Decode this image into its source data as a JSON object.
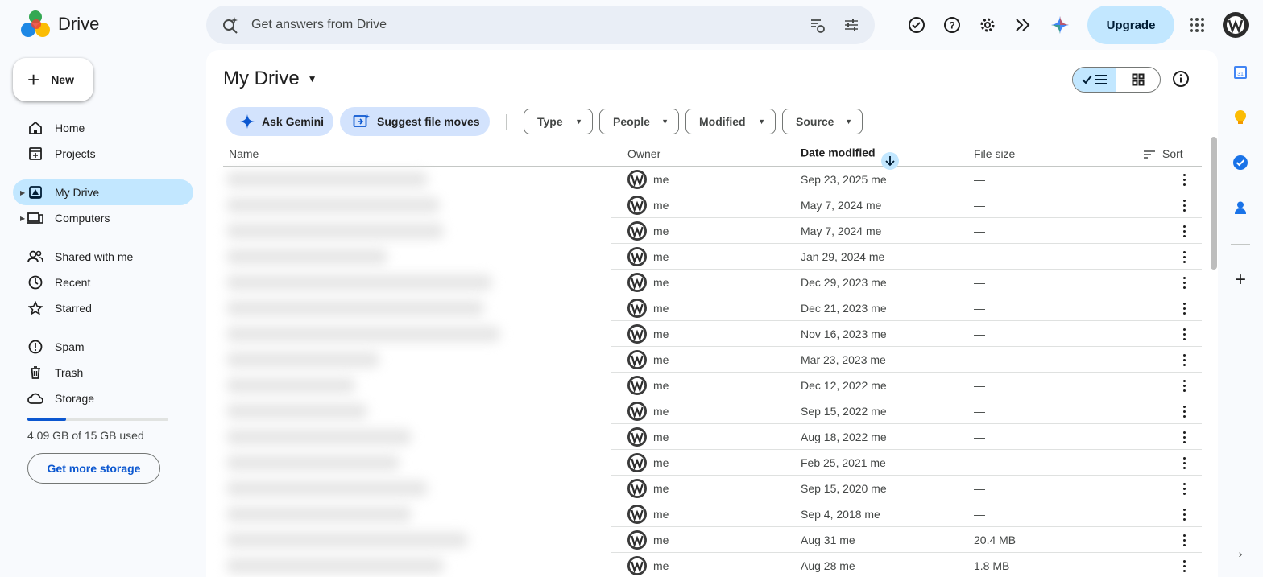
{
  "app": {
    "name": "Drive"
  },
  "search": {
    "placeholder": "Get answers from Drive"
  },
  "header": {
    "upgrade_label": "Upgrade",
    "icons": [
      "ready-for-offline-icon",
      "help-icon",
      "settings-icon",
      "gemini-workspace-icon",
      "gemini-sparkle-icon",
      "apps-grid-icon",
      "account-avatar"
    ]
  },
  "sidebar": {
    "new_label": "New",
    "items": [
      {
        "label": "Home",
        "icon": "home-icon"
      },
      {
        "label": "Projects",
        "icon": "projects-icon"
      },
      {
        "label": "My Drive",
        "icon": "my-drive-icon",
        "active": true
      },
      {
        "label": "Computers",
        "icon": "computers-icon"
      },
      {
        "label": "Shared with me",
        "icon": "shared-icon"
      },
      {
        "label": "Recent",
        "icon": "clock-icon"
      },
      {
        "label": "Starred",
        "icon": "star-icon"
      },
      {
        "label": "Spam",
        "icon": "spam-icon"
      },
      {
        "label": "Trash",
        "icon": "trash-icon"
      },
      {
        "label": "Storage",
        "icon": "cloud-icon"
      }
    ],
    "storage": {
      "text": "4.09 GB of 15 GB used",
      "used_fraction": 0.273,
      "button": "Get more storage"
    }
  },
  "main": {
    "title": "My Drive",
    "actions": {
      "ask_gemini": "Ask Gemini",
      "suggest_moves": "Suggest file moves"
    },
    "filters": [
      "Type",
      "People",
      "Modified",
      "Source"
    ],
    "columns": {
      "name": "Name",
      "owner": "Owner",
      "date": "Date modified",
      "size": "File size",
      "sort": "Sort"
    },
    "rows": [
      {
        "owner": "me",
        "date": "Sep 23, 2025 me",
        "size": "—"
      },
      {
        "owner": "me",
        "date": "May 7, 2024 me",
        "size": "—"
      },
      {
        "owner": "me",
        "date": "May 7, 2024 me",
        "size": "—"
      },
      {
        "owner": "me",
        "date": "Jan 29, 2024 me",
        "size": "—"
      },
      {
        "owner": "me",
        "date": "Dec 29, 2023 me",
        "size": "—"
      },
      {
        "owner": "me",
        "date": "Dec 21, 2023 me",
        "size": "—"
      },
      {
        "owner": "me",
        "date": "Nov 16, 2023 me",
        "size": "—"
      },
      {
        "owner": "me",
        "date": "Mar 23, 2023 me",
        "size": "—"
      },
      {
        "owner": "me",
        "date": "Dec 12, 2022 me",
        "size": "—"
      },
      {
        "owner": "me",
        "date": "Sep 15, 2022 me",
        "size": "—"
      },
      {
        "owner": "me",
        "date": "Aug 18, 2022 me",
        "size": "—"
      },
      {
        "owner": "me",
        "date": "Feb 25, 2021 me",
        "size": "—"
      },
      {
        "owner": "me",
        "date": "Sep 15, 2020 me",
        "size": "—"
      },
      {
        "owner": "me",
        "date": "Sep 4, 2018 me",
        "size": "—"
      },
      {
        "owner": "me",
        "date": "Aug 31 me",
        "size": "20.4 MB"
      },
      {
        "owner": "me",
        "date": "Aug 28 me",
        "size": "1.8 MB"
      }
    ]
  },
  "right_rail": {
    "icons": [
      "calendar-icon",
      "keep-icon",
      "tasks-icon",
      "contacts-icon",
      "add-addon-icon",
      "expand-panel-icon"
    ],
    "calendar_day": "31"
  },
  "colors": {
    "accent": "#0b57d0",
    "selected_bg": "#c2e7ff",
    "chip_bg": "#d3e3fd",
    "page_bg": "#f8fafd"
  }
}
